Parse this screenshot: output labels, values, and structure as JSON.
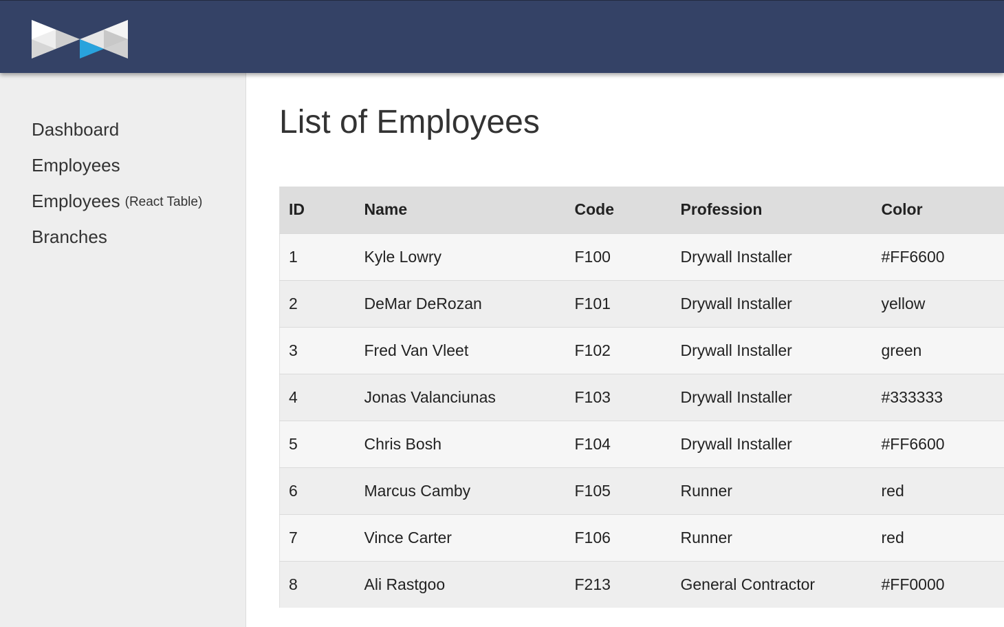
{
  "colors": {
    "header_bg": "#344266",
    "sidebar_bg": "#eeeeee",
    "table_header_bg": "#dddddd",
    "logo_accent": "#29a3dd"
  },
  "header": {
    "logo_icon": "bowtie-logo-icon"
  },
  "sidebar": {
    "items": [
      {
        "label": "Dashboard",
        "suffix": ""
      },
      {
        "label": "Employees",
        "suffix": ""
      },
      {
        "label": "Employees",
        "suffix": "(React Table)"
      },
      {
        "label": "Branches",
        "suffix": ""
      }
    ]
  },
  "main": {
    "title": "List of Employees",
    "table": {
      "columns": [
        "ID",
        "Name",
        "Code",
        "Profession",
        "Color"
      ],
      "rows": [
        [
          "1",
          "Kyle Lowry",
          "F100",
          "Drywall Installer",
          "#FF6600"
        ],
        [
          "2",
          "DeMar DeRozan",
          "F101",
          "Drywall Installer",
          "yellow"
        ],
        [
          "3",
          "Fred Van Vleet",
          "F102",
          "Drywall Installer",
          "green"
        ],
        [
          "4",
          "Jonas Valanciunas",
          "F103",
          "Drywall Installer",
          "#333333"
        ],
        [
          "5",
          "Chris Bosh",
          "F104",
          "Drywall Installer",
          "#FF6600"
        ],
        [
          "6",
          "Marcus Camby",
          "F105",
          "Runner",
          "red"
        ],
        [
          "7",
          "Vince Carter",
          "F106",
          "Runner",
          "red"
        ],
        [
          "8",
          "Ali Rastgoo",
          "F213",
          "General Contractor",
          "#FF0000"
        ]
      ]
    }
  }
}
